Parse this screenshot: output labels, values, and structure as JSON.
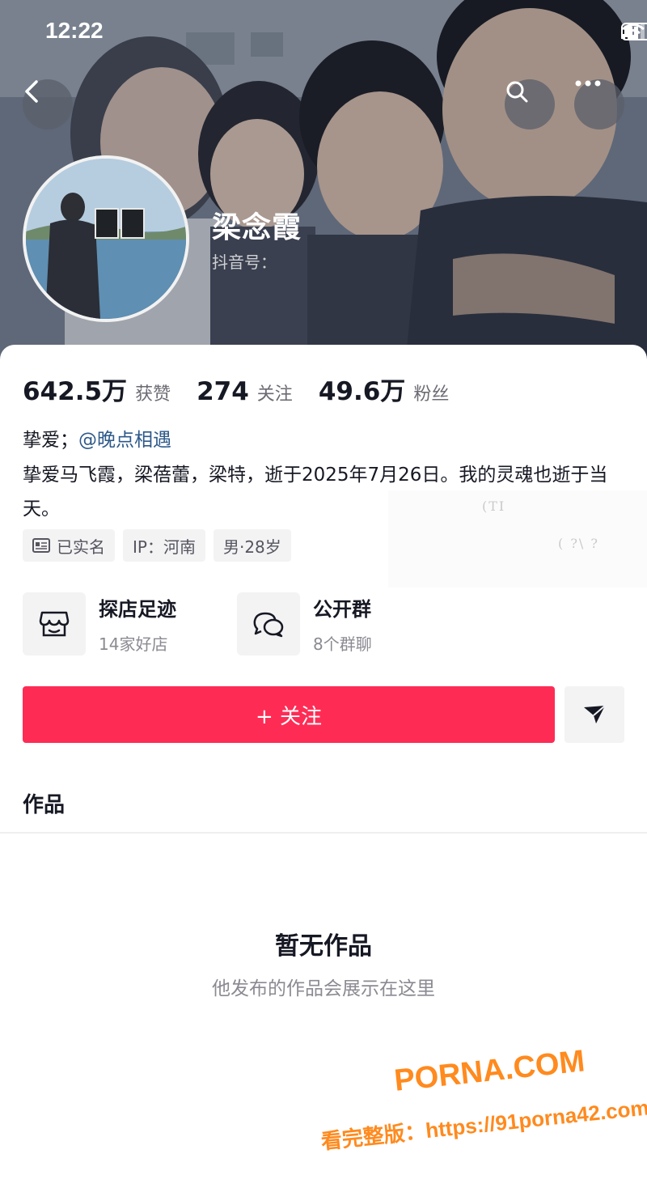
{
  "status_bar": {
    "time": "12:22"
  },
  "header": {
    "back_icon": "chevron-left-icon",
    "search_icon": "search-icon",
    "more_icon": "more-horizontal-icon"
  },
  "profile": {
    "name": "梁念霞",
    "douyin_id_label": "抖音号：",
    "stats": [
      {
        "value": "642.5万",
        "label": "获赞"
      },
      {
        "value": "274",
        "label": "关注"
      },
      {
        "value": "49.6万",
        "label": "粉丝"
      }
    ],
    "bio_line1_prefix": "挚爱；",
    "bio_mention": "@晚点相遇",
    "bio_text": "挚爱马飞霞，梁蓓蕾，梁特，逝于2025年7月26日。我的灵魂也逝于当天。",
    "tags": [
      {
        "icon": "id-card-icon",
        "label": "已实名"
      },
      {
        "icon": "",
        "label": "IP：河南"
      },
      {
        "icon": "",
        "label": "男·28岁"
      }
    ],
    "blurred_text_1": "(TI",
    "blurred_text_2": "( ?\\ ?"
  },
  "cards": [
    {
      "icon": "store-icon",
      "title": "探店足迹",
      "sub": "14家好店"
    },
    {
      "icon": "chat-bubbles-icon",
      "title": "公开群",
      "sub": "8个群聊"
    }
  ],
  "actions": {
    "follow_label": "+ 关注",
    "share_icon": "send-icon"
  },
  "tabs": {
    "works_label": "作品"
  },
  "empty_state": {
    "title": "暂无作品",
    "subtitle": "他发布的作品会展示在这里"
  },
  "watermark": {
    "brand": "PORNA.COM",
    "url_line": "看完整版：https://91porna42.com"
  },
  "colors": {
    "follow_button": "#fe2c55",
    "mention": "#2e5a8a",
    "watermark": "#ff8a1e"
  }
}
